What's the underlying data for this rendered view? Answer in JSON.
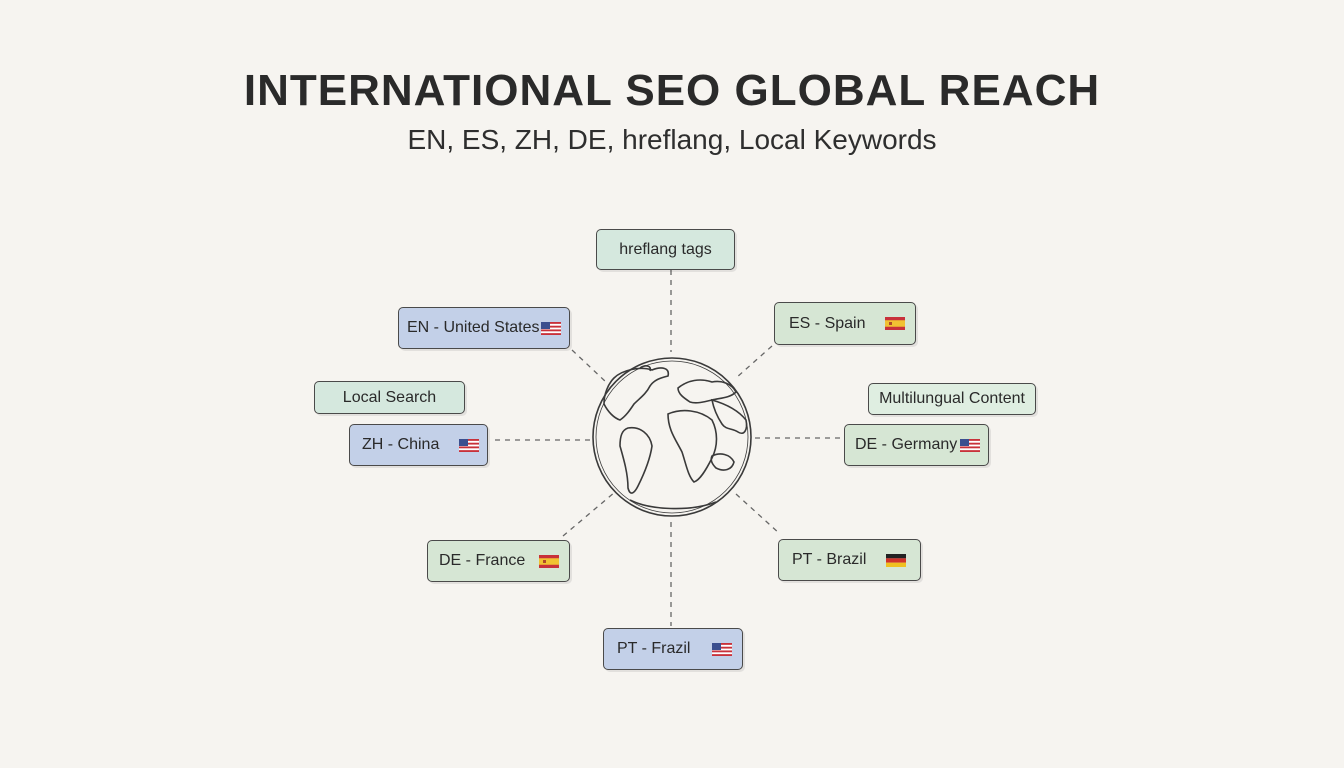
{
  "header": {
    "title": "INTERNATIONAL SEO GLOBAL REACH",
    "subtitle": "EN, ES, ZH, DE, hreflang, Local Keywords"
  },
  "nodes": {
    "hreflang": {
      "label": "hreflang tags"
    },
    "en_us": {
      "label": "EN - United States",
      "flag": "us-flag"
    },
    "es_spain": {
      "label": "ES - Spain",
      "flag": "spain-flag"
    },
    "local_search": {
      "label": "Local Search"
    },
    "multilingual": {
      "label": "Multilungual Content"
    },
    "zh_china": {
      "label": "ZH - China",
      "flag": "us-flag"
    },
    "de_germany": {
      "label": "DE - Germany",
      "flag": "us-flag"
    },
    "de_france": {
      "label": "DE - France",
      "flag": "spain-flag"
    },
    "pt_brazil": {
      "label": "PT - Brazil",
      "flag": "germany-flag"
    },
    "pt_frazil": {
      "label": "PT - Frazil",
      "flag": "us-flag"
    }
  },
  "colors": {
    "blue_node": "#c3d0e8",
    "green_node": "#d6e6d4",
    "mint_node": "#d5e8de",
    "background": "#f6f4f0"
  }
}
